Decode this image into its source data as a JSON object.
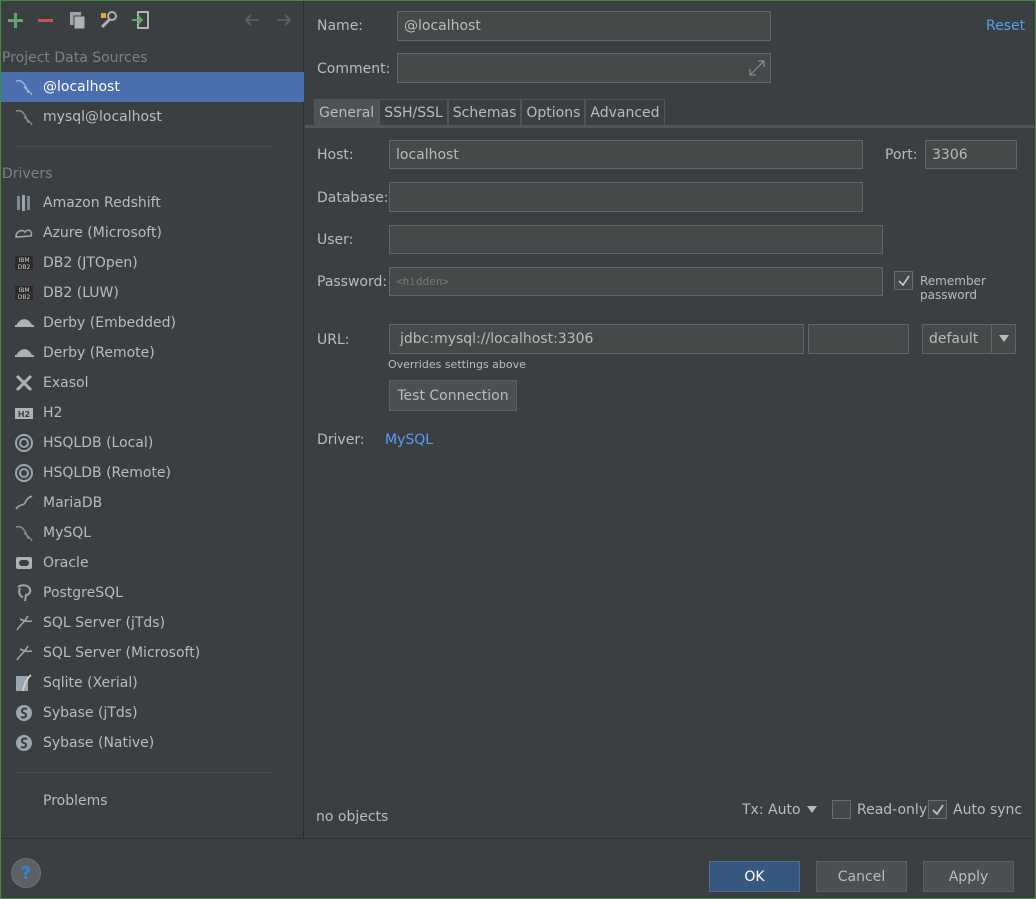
{
  "toolbar": {
    "add_icon": "plus-icon",
    "remove_icon": "minus-icon",
    "duplicate_icon": "copy-icon",
    "driver_icon": "wrench-icon",
    "import_icon": "import-icon",
    "back_icon": "arrow-left-icon",
    "forward_icon": "arrow-right-icon"
  },
  "sidebar": {
    "project_title": "Project Data Sources",
    "data_sources": [
      {
        "label": "@localhost",
        "selected": true
      },
      {
        "label": "mysql@localhost",
        "selected": false
      }
    ],
    "drivers_title": "Drivers",
    "drivers": [
      {
        "label": "Amazon Redshift",
        "icon": "redshift-icon"
      },
      {
        "label": "Azure (Microsoft)",
        "icon": "azure-icon"
      },
      {
        "label": "DB2 (JTOpen)",
        "icon": "db2-icon"
      },
      {
        "label": "DB2 (LUW)",
        "icon": "db2-icon"
      },
      {
        "label": "Derby (Embedded)",
        "icon": "derby-icon"
      },
      {
        "label": "Derby (Remote)",
        "icon": "derby-icon"
      },
      {
        "label": "Exasol",
        "icon": "exasol-icon"
      },
      {
        "label": "H2",
        "icon": "h2-icon"
      },
      {
        "label": "HSQLDB (Local)",
        "icon": "hsqldb-icon"
      },
      {
        "label": "HSQLDB (Remote)",
        "icon": "hsqldb-icon"
      },
      {
        "label": "MariaDB",
        "icon": "mariadb-icon"
      },
      {
        "label": "MySQL",
        "icon": "mysql-icon"
      },
      {
        "label": "Oracle",
        "icon": "oracle-icon"
      },
      {
        "label": "PostgreSQL",
        "icon": "postgresql-icon"
      },
      {
        "label": "SQL Server (jTds)",
        "icon": "sqlserver-icon"
      },
      {
        "label": "SQL Server (Microsoft)",
        "icon": "sqlserver-icon"
      },
      {
        "label": "Sqlite (Xerial)",
        "icon": "sqlite-icon"
      },
      {
        "label": "Sybase (jTds)",
        "icon": "sybase-icon"
      },
      {
        "label": "Sybase (Native)",
        "icon": "sybase-icon"
      }
    ],
    "problems": "Problems"
  },
  "form": {
    "name_label": "Name:",
    "name_value": "@localhost",
    "reset": "Reset",
    "comment_label": "Comment:",
    "comment_value": "",
    "tabs": [
      "General",
      "SSH/SSL",
      "Schemas",
      "Options",
      "Advanced"
    ],
    "active_tab": "General",
    "host_label": "Host:",
    "host_value": "localhost",
    "port_label": "Port:",
    "port_value": "3306",
    "database_label": "Database:",
    "database_value": "",
    "user_label": "User:",
    "user_value": "",
    "password_label": "Password:",
    "password_value": "<hidden>",
    "remember_password": "Remember password",
    "remember_checked": true,
    "url_label": "URL:",
    "url_value": "jdbc:mysql://localhost:3306",
    "url_extra": "",
    "url_mode": "default",
    "url_hint": "Overrides settings above",
    "test_connection": "Test Connection",
    "driver_label": "Driver:",
    "driver_value": "MySQL"
  },
  "status": {
    "objects": "no objects",
    "tx": "Tx: Auto",
    "readonly": "Read-only",
    "readonly_checked": false,
    "autosync": "Auto sync",
    "autosync_checked": true
  },
  "dialog": {
    "help": "?",
    "ok": "OK",
    "cancel": "Cancel",
    "apply": "Apply"
  },
  "colors": {
    "accent": "#4b6eaf",
    "link": "#589df6",
    "background": "#3c3f41",
    "add": "#59a869",
    "remove": "#c75450"
  }
}
